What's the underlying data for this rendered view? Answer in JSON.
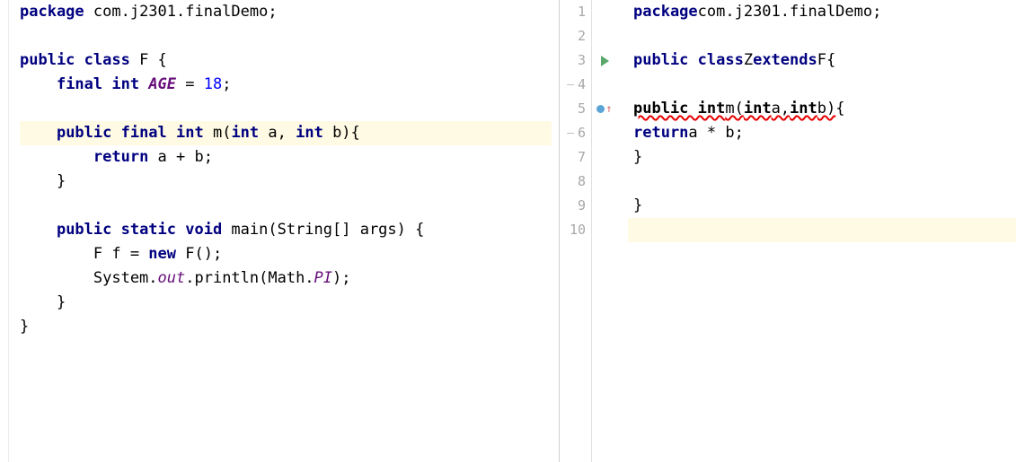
{
  "left": {
    "lines": [
      {
        "tokens": [
          {
            "t": "package ",
            "c": "kw"
          },
          {
            "t": "com.j2301.finalDemo;",
            "c": "plain"
          }
        ]
      },
      {
        "tokens": [
          {
            "t": "",
            "c": "plain"
          }
        ]
      },
      {
        "tokens": [
          {
            "t": "public class ",
            "c": "kw"
          },
          {
            "t": "F {",
            "c": "plain"
          }
        ]
      },
      {
        "tokens": [
          {
            "t": "    ",
            "c": "plain"
          },
          {
            "t": "final int ",
            "c": "kw"
          },
          {
            "t": "AGE",
            "c": "field"
          },
          {
            "t": " = ",
            "c": "plain"
          },
          {
            "t": "18",
            "c": "num"
          },
          {
            "t": ";",
            "c": "plain"
          }
        ]
      },
      {
        "tokens": [
          {
            "t": "",
            "c": "plain"
          }
        ]
      },
      {
        "hl": true,
        "tokens": [
          {
            "t": "    ",
            "c": "plain"
          },
          {
            "t": "public final int ",
            "c": "kw"
          },
          {
            "t": "m(",
            "c": "plain"
          },
          {
            "t": "int ",
            "c": "kw"
          },
          {
            "t": "a, ",
            "c": "plain"
          },
          {
            "t": "int ",
            "c": "kw"
          },
          {
            "t": "b){",
            "c": "plain"
          }
        ]
      },
      {
        "tokens": [
          {
            "t": "        ",
            "c": "plain"
          },
          {
            "t": "return ",
            "c": "kw"
          },
          {
            "t": "a + b;",
            "c": "plain"
          }
        ]
      },
      {
        "tokens": [
          {
            "t": "    }",
            "c": "plain"
          }
        ]
      },
      {
        "tokens": [
          {
            "t": "",
            "c": "plain"
          }
        ]
      },
      {
        "tokens": [
          {
            "t": "    ",
            "c": "plain"
          },
          {
            "t": "public static void ",
            "c": "kw"
          },
          {
            "t": "main(String[] args) {",
            "c": "plain"
          }
        ]
      },
      {
        "tokens": [
          {
            "t": "        F f = ",
            "c": "plain"
          },
          {
            "t": "new ",
            "c": "kw"
          },
          {
            "t": "F();",
            "c": "plain"
          }
        ]
      },
      {
        "tokens": [
          {
            "t": "        System.",
            "c": "plain"
          },
          {
            "t": "out",
            "c": "static"
          },
          {
            "t": ".println(Math.",
            "c": "plain"
          },
          {
            "t": "PI",
            "c": "static"
          },
          {
            "t": ");",
            "c": "plain"
          }
        ]
      },
      {
        "tokens": [
          {
            "t": "    }",
            "c": "plain"
          }
        ]
      },
      {
        "tokens": [
          {
            "t": "}",
            "c": "plain"
          }
        ]
      }
    ]
  },
  "right": {
    "numbers": [
      "1",
      "2",
      "3",
      "4",
      "5",
      "6",
      "7",
      "8",
      "9",
      "10"
    ],
    "icons": [
      "",
      "",
      "run",
      "dash",
      "override",
      "dash",
      "",
      "",
      "",
      ""
    ],
    "lines": [
      {
        "tokens": [
          {
            "t": "package ",
            "c": "kw"
          },
          {
            "t": "com.j2301.finalDemo;",
            "c": "plain"
          }
        ]
      },
      {
        "tokens": [
          {
            "t": "",
            "c": "plain"
          }
        ]
      },
      {
        "tokens": [
          {
            "t": "public class ",
            "c": "kw"
          },
          {
            "t": "Z ",
            "c": "plain"
          },
          {
            "t": "extends ",
            "c": "kw"
          },
          {
            "t": "F{",
            "c": "plain"
          }
        ]
      },
      {
        "tokens": [
          {
            "t": "",
            "c": "plain"
          }
        ]
      },
      {
        "tokens": [
          {
            "t": "     ",
            "c": "plain"
          },
          {
            "t": "public int ",
            "c": "kw err"
          },
          {
            "t": "m(",
            "c": "err"
          },
          {
            "t": "int ",
            "c": "kw err"
          },
          {
            "t": "a,",
            "c": "err"
          },
          {
            "t": "int ",
            "c": "kw err"
          },
          {
            "t": "b)",
            "c": "err"
          },
          {
            "t": "{",
            "c": "plain"
          }
        ]
      },
      {
        "tokens": [
          {
            "t": "         ",
            "c": "plain"
          },
          {
            "t": "return ",
            "c": "kw"
          },
          {
            "t": "a * b;",
            "c": "plain"
          }
        ]
      },
      {
        "tokens": [
          {
            "t": "     }",
            "c": "plain"
          }
        ]
      },
      {
        "tokens": [
          {
            "t": "",
            "c": "plain"
          }
        ]
      },
      {
        "tokens": [
          {
            "t": "}",
            "c": "plain"
          }
        ]
      },
      {
        "hl": true,
        "tokens": [
          {
            "t": "",
            "c": "plain"
          }
        ]
      }
    ]
  },
  "colors": {
    "keyword": "#000080",
    "number": "#0000ff",
    "field": "#660e7a",
    "highlight": "#fffae3",
    "error_underline": "#e60000"
  }
}
